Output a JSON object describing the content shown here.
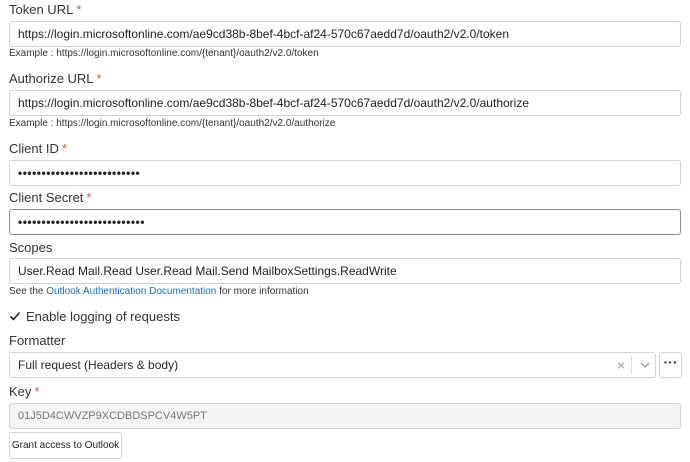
{
  "token_url": {
    "label": "Token URL",
    "required": "*",
    "value": "https://login.microsoftonline.com/ae9cd38b-8bef-4bcf-af24-570c67aedd7d/oauth2/v2.0/token",
    "example": "Example : https://login.microsoftonline.com/{tenant}/oauth2/v2.0/token"
  },
  "authorize_url": {
    "label": "Authorize URL",
    "required": "*",
    "value": "https://login.microsoftonline.com/ae9cd38b-8bef-4bcf-af24-570c67aedd7d/oauth2/v2.0/authorize",
    "example": "Example : https://login.microsoftonline.com/{tenant}/oauth2/v2.0/authorize"
  },
  "client_id": {
    "label": "Client ID",
    "required": "*",
    "value": "••••••••••••••••••••••••••"
  },
  "client_secret": {
    "label": "Client Secret",
    "required": "*",
    "value": "•••••••••••••••••••••••••••"
  },
  "scopes": {
    "label": "Scopes",
    "value": "User.Read Mail.Read User.Read Mail.Send MailboxSettings.ReadWrite",
    "help_prefix": "See the",
    "help_link": "Outlook Authentication Documentation",
    "help_suffix": "for more information"
  },
  "logging": {
    "label": "Enable logging of requests",
    "checked": true
  },
  "formatter": {
    "label": "Formatter",
    "selected": "Full request (Headers & body)",
    "clear_glyph": "×",
    "more_glyph": "···"
  },
  "key": {
    "label": "Key",
    "required": "*",
    "value": "01J5D4CWVZP9XCDBDSPCV4W5PT"
  },
  "grant_button": {
    "label": "Grant access to Outlook"
  },
  "colors": {
    "required": "#d9534f",
    "link": "#1a6fc0",
    "border": "#cfd4da"
  }
}
